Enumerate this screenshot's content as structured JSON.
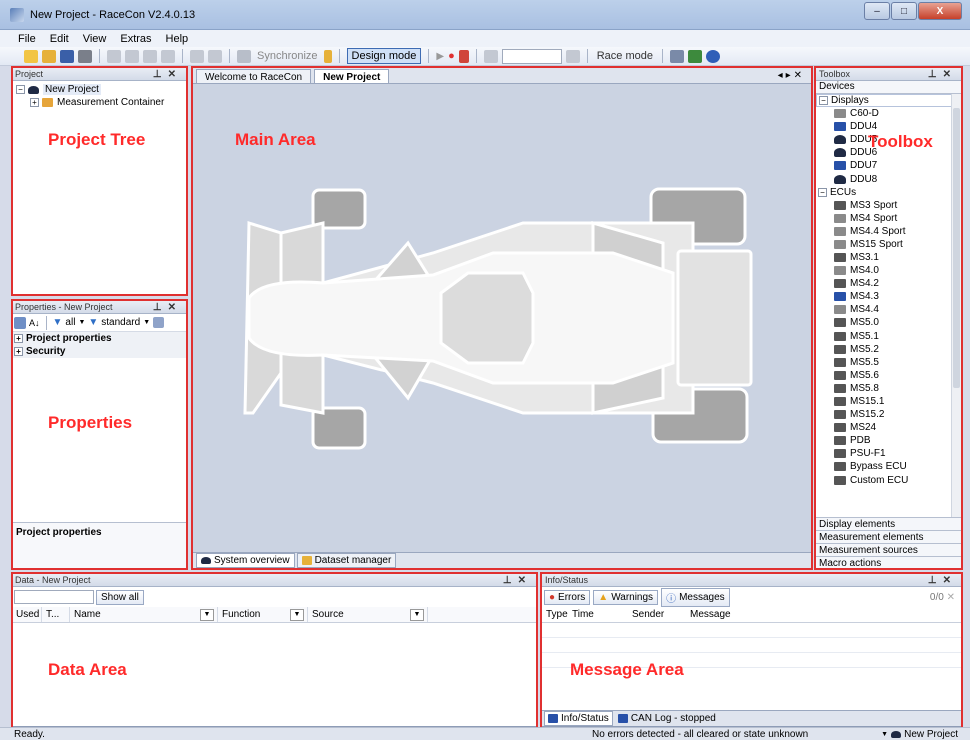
{
  "window": {
    "title": "New Project - RaceCon V2.4.0.13",
    "buttons": [
      "–",
      "□",
      "X"
    ]
  },
  "menu": [
    "File",
    "Edit",
    "View",
    "Extras",
    "Help"
  ],
  "toolbar": {
    "synchronize": "Synchronize",
    "design_mode": "Design mode",
    "race_mode": "Race mode"
  },
  "project": {
    "header": "Project",
    "root": "New Project",
    "child": "Measurement Container",
    "label": "Project Tree"
  },
  "properties": {
    "header": "Properties - New Project",
    "filter_all": "all",
    "filter_standard": "standard",
    "sections": [
      "Project properties",
      "Security"
    ],
    "label": "Properties",
    "footer": "Project properties"
  },
  "main": {
    "tabs": [
      "Welcome to RaceCon",
      "New Project"
    ],
    "label": "Main Area",
    "bottom_tabs": [
      "System overview",
      "Dataset manager"
    ]
  },
  "toolbox": {
    "header": "Toolbox",
    "devices": "Devices",
    "label": "Toolbox",
    "displays_cat": "Displays",
    "displays": [
      "C60-D",
      "DDU4",
      "DDU5",
      "DDU6",
      "DDU7",
      "DDU8"
    ],
    "ecus_cat": "ECUs",
    "ecus": [
      "MS3 Sport",
      "MS4 Sport",
      "MS4.4 Sport",
      "MS15 Sport",
      "MS3.1",
      "MS4.0",
      "MS4.2",
      "MS4.3",
      "MS4.4",
      "MS5.0",
      "MS5.1",
      "MS5.2",
      "MS5.5",
      "MS5.6",
      "MS5.8",
      "MS15.1",
      "MS15.2",
      "MS24",
      "PDB",
      "PSU-F1",
      "Bypass ECU",
      "Custom ECU"
    ],
    "sections": [
      "Display elements",
      "Measurement elements",
      "Measurement sources",
      "Macro actions"
    ]
  },
  "data": {
    "header": "Data - New Project",
    "show_all": "Show all",
    "columns": [
      "Used",
      "T...",
      "Name",
      "Function",
      "Source"
    ],
    "label": "Data Area"
  },
  "info": {
    "header": "Info/Status",
    "errors": "Errors",
    "warnings": "Warnings",
    "messages": "Messages",
    "count": "0/0",
    "columns": [
      "Type",
      "Time",
      "Sender",
      "Message"
    ],
    "label": "Message Area",
    "tabs": [
      "Info/Status",
      "CAN Log - stopped"
    ]
  },
  "status": {
    "left": "Ready.",
    "center": "No errors detected - all cleared or state unknown",
    "right": "New Project"
  },
  "colors": {
    "highlight": "#e03030",
    "accent": "#3d6bb3"
  }
}
